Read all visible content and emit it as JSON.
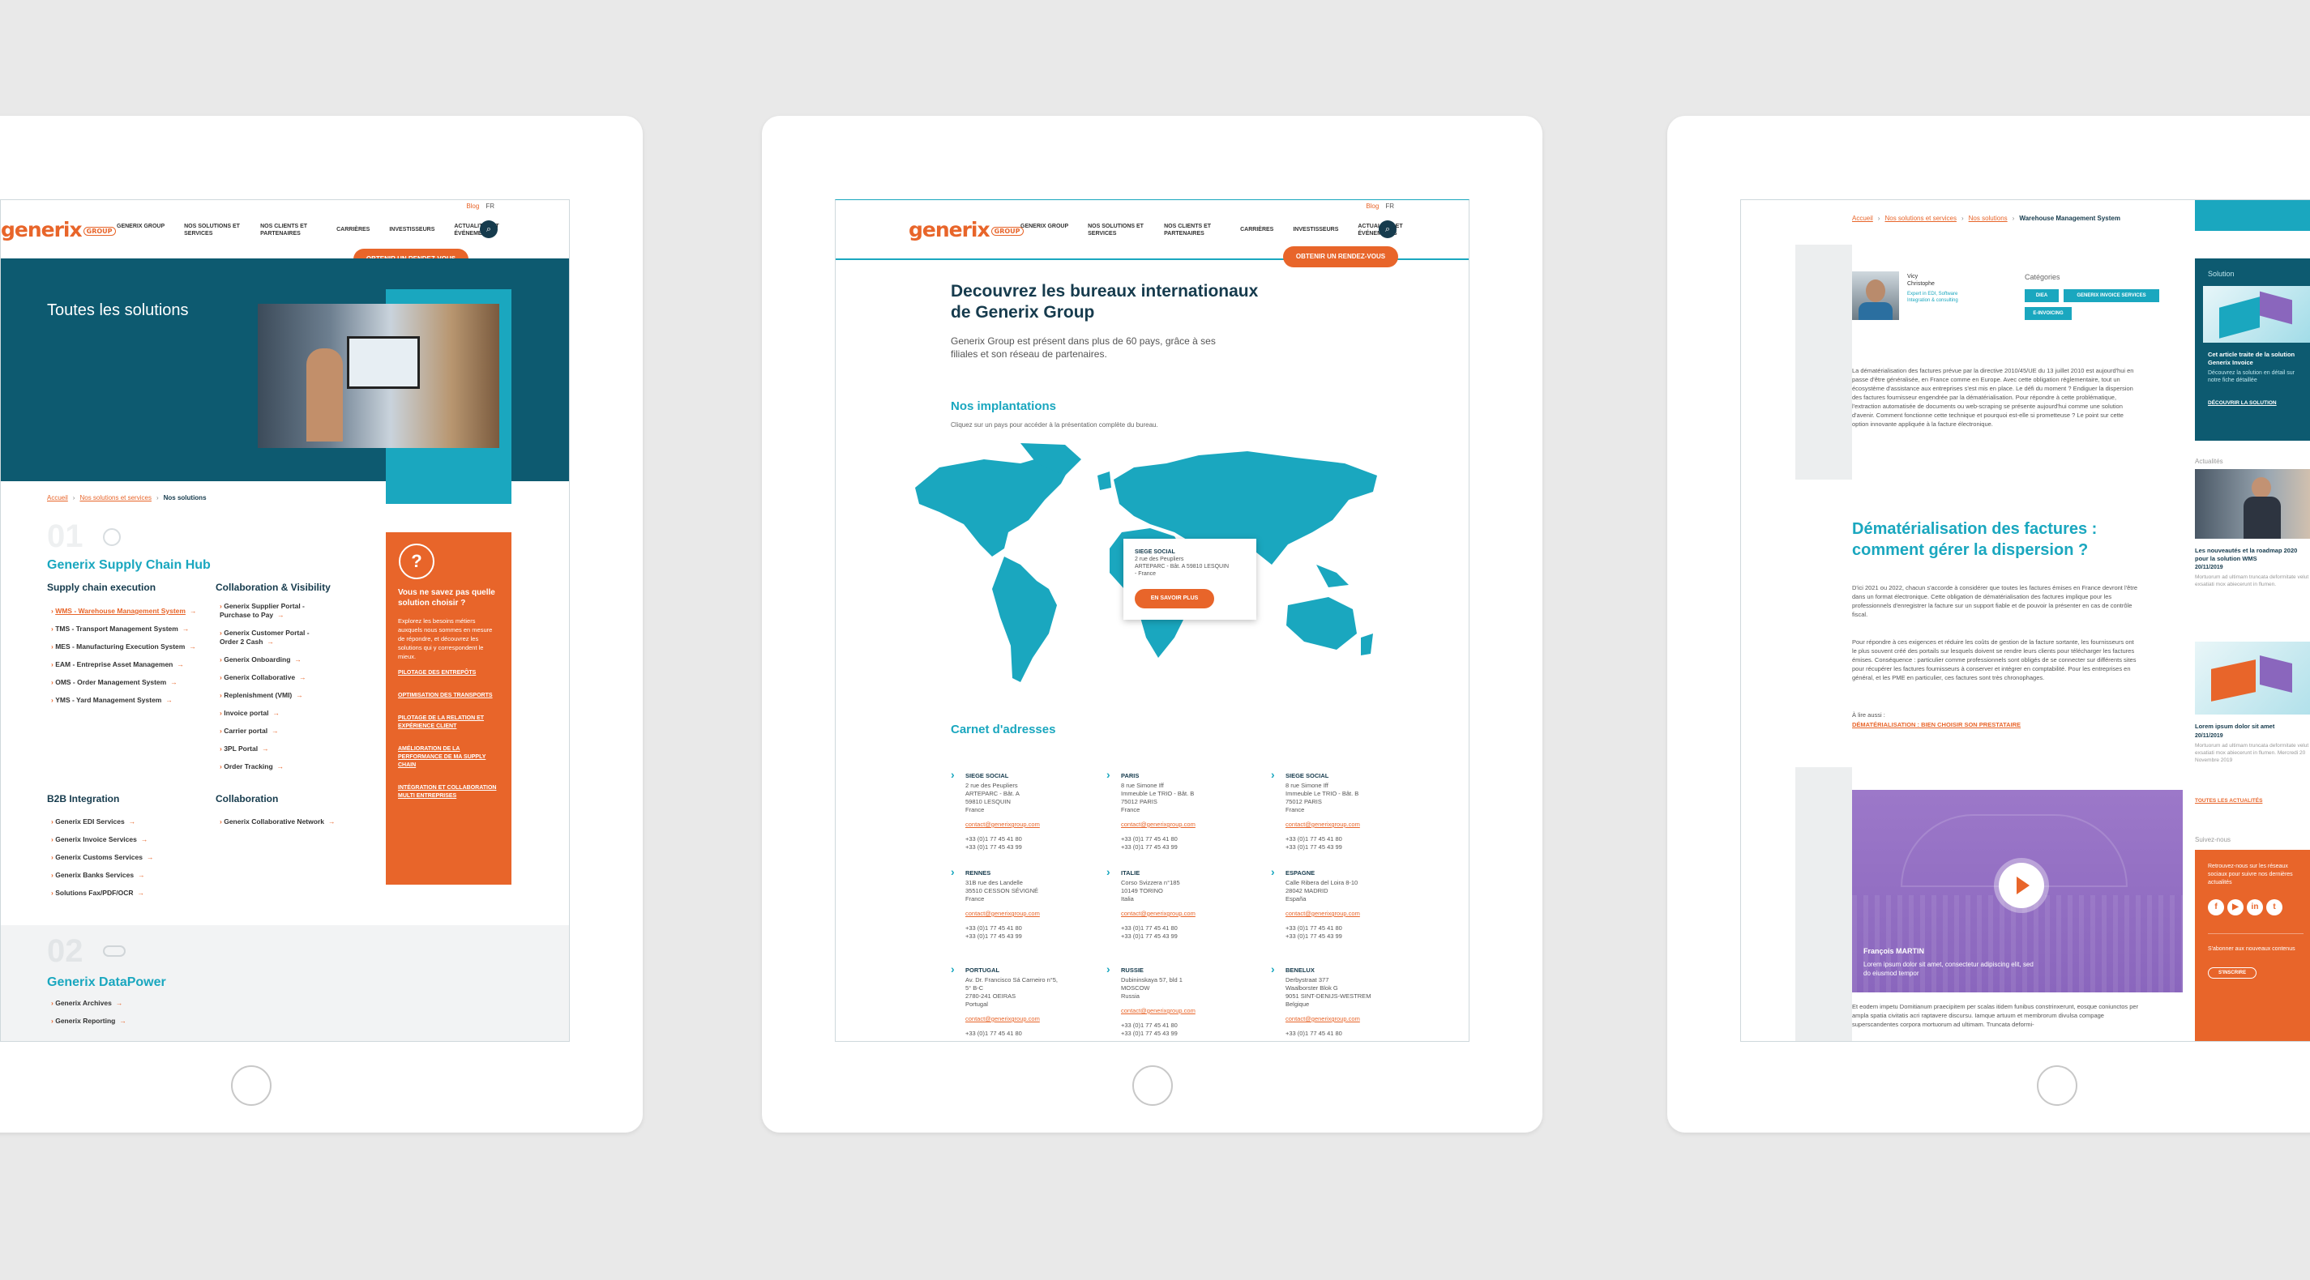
{
  "colors": {
    "teal": "#1aa7bf",
    "dark_teal": "#0d5a70",
    "orange": "#e8652a",
    "navy": "#163b4d"
  },
  "header": {
    "blog": "Blog",
    "lang": "FR",
    "logo": "generix",
    "logo_badge": "GROUP",
    "rdv": "OBTENIR UN RENDEZ-VOUS",
    "search_icon": "search-icon",
    "nav": [
      "GENERIX GROUP",
      "NOS SOLUTIONS ET SERVICES",
      "NOS CLIENTS ET PARTENAIRES",
      "CARRIÈRES",
      "INVESTISSEURS",
      "ACTUALITÉS ET ÉVÉNEMENTS"
    ]
  },
  "t1": {
    "hero_title": "Toutes les solutions",
    "crumb": {
      "a": "Accueil",
      "b": "Nos solutions et services",
      "c": "Nos solutions"
    },
    "n1": "01",
    "sec1": "Generix Supply Chain Hub",
    "col1_title": "Supply chain execution",
    "col1": [
      "WMS - Warehouse Management System",
      "TMS - Transport Management System",
      "MES - Manufacturing Execution System",
      "EAM - Entreprise Asset Managemen",
      "OMS - Order Management System",
      "YMS - Yard Management System"
    ],
    "col2_title": "Collaboration & Visibility",
    "col2": [
      "Generix Supplier Portal - Purchase to Pay",
      "Generix Customer Portal - Order 2 Cash",
      "Generix Onboarding",
      "Generix Collaborative",
      "Replenishment (VMI)",
      "Invoice portal",
      "Carrier portal",
      "3PL Portal",
      "Order Tracking"
    ],
    "b2b_title": "B2B Integration",
    "b2b": [
      "Generix EDI Services",
      "Generix Invoice Services",
      "Generix Customs Services",
      "Generix Banks Services",
      "Solutions Fax/PDF/OCR"
    ],
    "collab_title": "Collaboration",
    "collab": [
      "Generix Collaborative Network"
    ],
    "n2": "02",
    "sec2": "Generix DataPower",
    "dp": [
      "Generix Archives",
      "Generix Reporting"
    ],
    "box": {
      "q": "Vous ne savez pas quelle solution choisir ?",
      "text": "Explorez les besoins métiers auxquels nous sommes en mesure de répondre, et découvrez les solutions qui y correspondent le mieux.",
      "links": [
        "PILOTAGE DES ENTREPÔTS",
        "OPTIMISATION DES TRANSPORTS",
        "PILOTAGE DE LA RELATION ET EXPÉRIENCE CLIENT",
        "AMÉLIORATION DE LA PERFORMANCE DE MA SUPPLY CHAIN",
        "INTÉGRATION ET COLLABORATION MULTI ENTREPRISES"
      ]
    }
  },
  "t2": {
    "title": "Decouvrez les bureaux internationaux de Generix Group",
    "intro": "Generix Group est présent dans plus de 60 pays, grâce à ses filiales et son réseau de partenaires.",
    "impl": "Nos implantations",
    "impl_sub": "Cliquez sur un pays pour accéder à la présentation complète du bureau.",
    "popup": {
      "t": "SIEGE SOCIAL",
      "l1": "2 rue des Peupliers",
      "l2": "ARTEPARC - Bât. A 59810 LESQUIN - France",
      "btn": "EN SAVOIR PLUS"
    },
    "carnet": "Carnet d'adresses",
    "addresses": [
      {
        "t": "SIEGE SOCIAL",
        "l": [
          "2 rue des Peupliers",
          "ARTEPARC - Bât. A",
          "59810 LESQUIN",
          "France"
        ],
        "m": "contact@generixgroup.com",
        "p": [
          "+33 (0)1 77 45 41 80",
          "+33 (0)1 77 45 43 99"
        ]
      },
      {
        "t": "PARIS",
        "l": [
          "8 rue Simone Iff",
          "Immeuble Le TRIO - Bât. B",
          "75012 PARIS",
          "France"
        ],
        "m": "contact@generixgroup.com",
        "p": [
          "+33 (0)1 77 45 41 80",
          "+33 (0)1 77 45 43 99"
        ]
      },
      {
        "t": "SIEGE SOCIAL",
        "l": [
          "8 rue Simone Iff",
          "Immeuble Le TRIO - Bât. B",
          "75012 PARIS",
          "France"
        ],
        "m": "contact@generixgroup.com",
        "p": [
          "+33 (0)1 77 45 41 80",
          "+33 (0)1 77 45 43 99"
        ]
      },
      {
        "t": "RENNES",
        "l": [
          "31B rue des Landelle",
          "35510 CESSON SÉVIGNÉ",
          "France"
        ],
        "m": "contact@generixgroup.com",
        "p": [
          "+33 (0)1 77 45 41 80",
          "+33 (0)1 77 45 43 99"
        ]
      },
      {
        "t": "ITALIE",
        "l": [
          "Corso Svizzera n°185",
          "10149 TORINO",
          "Italia"
        ],
        "m": "contact@generixgroup.com",
        "p": [
          "+33 (0)1 77 45 41 80",
          "+33 (0)1 77 45 43 99"
        ]
      },
      {
        "t": "ESPAGNE",
        "l": [
          "Calle Ribera del Loira 8-10",
          "28042 MADRID",
          "España"
        ],
        "m": "contact@generixgroup.com",
        "p": [
          "+33 (0)1 77 45 41 80",
          "+33 (0)1 77 45 43 99"
        ]
      },
      {
        "t": "PORTUGAL",
        "l": [
          "Av. Dr. Francisco Sá Carneiro n°5,",
          "5° B-C",
          "2780-241 OEIRAS",
          "Portugal"
        ],
        "m": "contact@generixgroup.com",
        "p": [
          "+33 (0)1 77 45 41 80"
        ]
      },
      {
        "t": "RUSSIE",
        "l": [
          "Dubininskaya 57, bld 1",
          "MOSCOW",
          "Russia"
        ],
        "m": "contact@generixgroup.com",
        "p": [
          "+33 (0)1 77 45 41 80",
          "+33 (0)1 77 45 43 99"
        ]
      },
      {
        "t": "BENELUX",
        "l": [
          "Derbystraat 377",
          "Waalborster Blok G",
          "9051 SINT-DENIJS-WESTREM",
          "Belgique"
        ],
        "m": "contact@generixgroup.com",
        "p": [
          "+33 (0)1 77 45 41 80"
        ]
      }
    ]
  },
  "t3": {
    "crumb": {
      "a": "Accueil",
      "b": "Nos solutions et services",
      "c": "Nos solutions",
      "d": "Warehouse Management System"
    },
    "author": {
      "name": "Vicy Christophe",
      "role": "Expert in EDI, Software Integration & consulting"
    },
    "cats_title": "Catégories",
    "cats": [
      "DIEA",
      "GENERIX INVOICE SERVICES",
      "E-INVOICING"
    ],
    "p1": "La dématérialisation des factures prévue par la directive 2010/45/UE du 13 juillet 2010 est aujourd'hui en passe d'être généralisée, en France comme en Europe. Avec cette obligation réglementaire, tout un écosystème d'assistance aux entreprises s'est mis en place. Le défi du moment ? Endiguer la dispersion des factures fournisseur engendrée par la dématérialisation. Pour répondre à cette problématique, l'extraction automatisée de documents ou web-scraping se présente aujourd'hui comme une solution d'avenir. Comment fonctionne cette technique et pourquoi est-elle si prometteuse ? Le point sur cette option innovante appliquée à la facture électronique.",
    "h2": "Dématérialisation des factures : comment gérer la dispersion ?",
    "p2": "D'ici 2021 ou 2022, chacun s'accorde à considérer que toutes les factures émises en France devront l'être dans un format électronique. Cette obligation de dématérialisation des factures implique pour les professionnels d'enregistrer la facture sur un support fiable et de pouvoir la présenter en cas de contrôle fiscal.",
    "p3": "Pour répondre à ces exigences et réduire les coûts de gestion de la facture sortante, les fournisseurs ont le plus souvent créé des portails sur lesquels doivent se rendre leurs clients pour télécharger les factures émises. Conséquence : particulier comme professionnels sont obligés de se connecter sur différents sites pour récupérer les factures fournisseurs à conserver et intégrer en comptabilité. Pour les entreprises en général, et les PME en particulier, ces factures sont très chronophages.",
    "alire": "À lire aussi :",
    "alire_link": "DÉMATÉRIALISATION : BIEN CHOISIR SON PRESTATAIRE",
    "video_name": "François MARTIN",
    "video_txt": "Lorem ipsum dolor sit amet, consectetur adipiscing elit, sed do eiusmod tempor",
    "p4": "Et eodem impetu Domitianum praecipitem per scalas itidem funibus constrinxerunt, eosque coniunctos per ampla spatia civitatis acri raptavere discursu. Iamque artuum et membrorum divulsa compage superscandentes corpora mortuorum ad ultimam. Truncata deformi-",
    "side_sol": "Solution",
    "side_sol_txt": "Cet article traite de la solution Generix Invoice",
    "side_sol_sub": "Découvrez la solution en détail sur notre fiche détaillée",
    "side_sol_link": "DÉCOUVRIR LA SOLUTION",
    "actu": "Actualités",
    "news1": "Les nouveautés et la roadmap 2020 pour la solution WMS",
    "news1_date": "20/11/2019",
    "news1_txt": "Mortuorum ad ultimam truncata deformitate velut exsatiati mox abiecerunt in flumen.",
    "news2": "Lorem ipsum dolor sit amet",
    "news2_date": "20/11/2019",
    "news2_txt": "Mortuorum ad ultimam truncata deformitate velut exsatiati mox abiecerunt in flumen. Mercredi 20 Novembre 2019",
    "all_news": "TOUTES LES ACTUALITÉS",
    "suivez": "Suivez-nous",
    "social_txt": "Retrouvez-nous sur les réseaux sociaux pour suivre nos dernières actualités",
    "nl": "S'abonner aux nouveaux contenus",
    "nl_btn": "S'INSCRIRE"
  }
}
